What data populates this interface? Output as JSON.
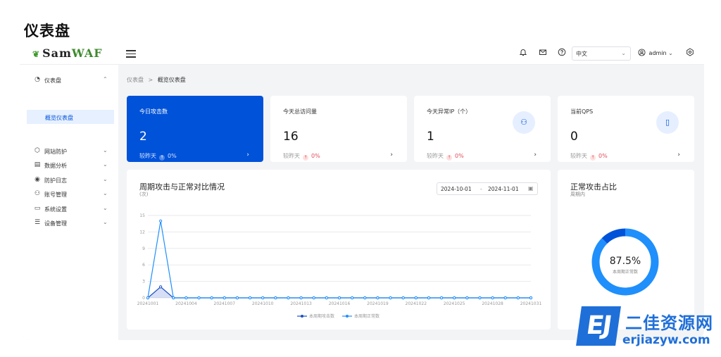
{
  "page_title": "仪表盘",
  "colors": {
    "primary": "#0052d9",
    "accent": "#1f8ffb",
    "danger": "#e34d59"
  },
  "brand": {
    "leaf": "❦",
    "name_a": "Sam",
    "name_b": "WAF"
  },
  "header": {
    "lang_value": "中文",
    "user": "admin",
    "icons": [
      "menu-icon",
      "bell-icon",
      "mail-icon",
      "help-icon",
      "user-icon",
      "gear-icon"
    ]
  },
  "sidebar": {
    "items": [
      {
        "label": "仪表盘",
        "icon": "dashboard-icon",
        "expanded": true
      },
      {
        "label": "网站防护",
        "icon": "shield-icon"
      },
      {
        "label": "数据分析",
        "icon": "chart-icon"
      },
      {
        "label": "防护日志",
        "icon": "log-icon"
      },
      {
        "label": "账号管理",
        "icon": "users-icon"
      },
      {
        "label": "系统设置",
        "icon": "monitor-icon"
      },
      {
        "label": "设备管理",
        "icon": "device-icon"
      }
    ],
    "active_sub": "概览仪表盘"
  },
  "breadcrumb": {
    "root": "仪表盘",
    "sep": ">",
    "current": "概览仪表盘"
  },
  "stats": [
    {
      "title": "今日攻击数",
      "value": "2",
      "foot": "较昨天",
      "pct": "0%",
      "arrow": "›"
    },
    {
      "title": "今天总访问量",
      "value": "16",
      "foot": "较昨天",
      "pct": "0%",
      "arrow": "›"
    },
    {
      "title": "今天异常IP（个）",
      "value": "1",
      "foot": "较昨天",
      "pct": "0%",
      "arrow": "›"
    },
    {
      "title": "当前QPS",
      "value": "0",
      "foot": "较昨天",
      "pct": "0%",
      "arrow": "›"
    }
  ],
  "trend": {
    "title": "周期攻击与正常对比情况",
    "subtitle": "(次)",
    "date_start": "2024-10-01",
    "date_sep": "-",
    "date_end": "2024-11-01"
  },
  "pie": {
    "title": "正常攻击占比",
    "subtitle": "周期内",
    "center_value": "87.5%",
    "center_label": "本周期正常数"
  },
  "chart_data": {
    "type": "line",
    "ylim": [
      0,
      15
    ],
    "yticks": [
      0,
      3,
      6,
      9,
      12,
      15
    ],
    "x": [
      "20241001",
      "20241002",
      "20241003",
      "20241004",
      "20241005",
      "20241006",
      "20241007",
      "20241008",
      "20241009",
      "20241010",
      "20241011",
      "20241012",
      "20241013",
      "20241014",
      "20241015",
      "20241016",
      "20241017",
      "20241018",
      "20241019",
      "20241020",
      "20241021",
      "20241022",
      "20241023",
      "20241024",
      "20241025",
      "20241026",
      "20241027",
      "20241028",
      "20241029",
      "20241030",
      "20241031"
    ],
    "xtick_labels": [
      "20241001",
      "20241004",
      "20241007",
      "20241010",
      "20241013",
      "20241016",
      "20241019",
      "20241022",
      "20241025",
      "20241028",
      "20241031"
    ],
    "series": [
      {
        "name": "本周期攻击数",
        "color": "#1b4fc6",
        "values": [
          0,
          2,
          0,
          0,
          0,
          0,
          0,
          0,
          0,
          0,
          0,
          0,
          0,
          0,
          0,
          0,
          0,
          0,
          0,
          0,
          0,
          0,
          0,
          0,
          0,
          0,
          0,
          0,
          0,
          0,
          0
        ]
      },
      {
        "name": "本周期正常数",
        "color": "#1f8ffb",
        "values": [
          0,
          14,
          0,
          0,
          0,
          0,
          0,
          0,
          0,
          0,
          0,
          0,
          0,
          0,
          0,
          0,
          0,
          0,
          0,
          0,
          0,
          0,
          0,
          0,
          0,
          0,
          0,
          0,
          0,
          0,
          0
        ]
      }
    ]
  },
  "pie_data": {
    "type": "pie",
    "slices": [
      {
        "name": "本周期正常数",
        "value": 87.5,
        "color": "#1f8ffb"
      },
      {
        "name": "本周期攻击数",
        "value": 12.5,
        "color": "#0052d9"
      }
    ]
  },
  "watermark": {
    "logo": "EJ",
    "cn": "二佳资源网",
    "url": "erjiazyw.com"
  }
}
